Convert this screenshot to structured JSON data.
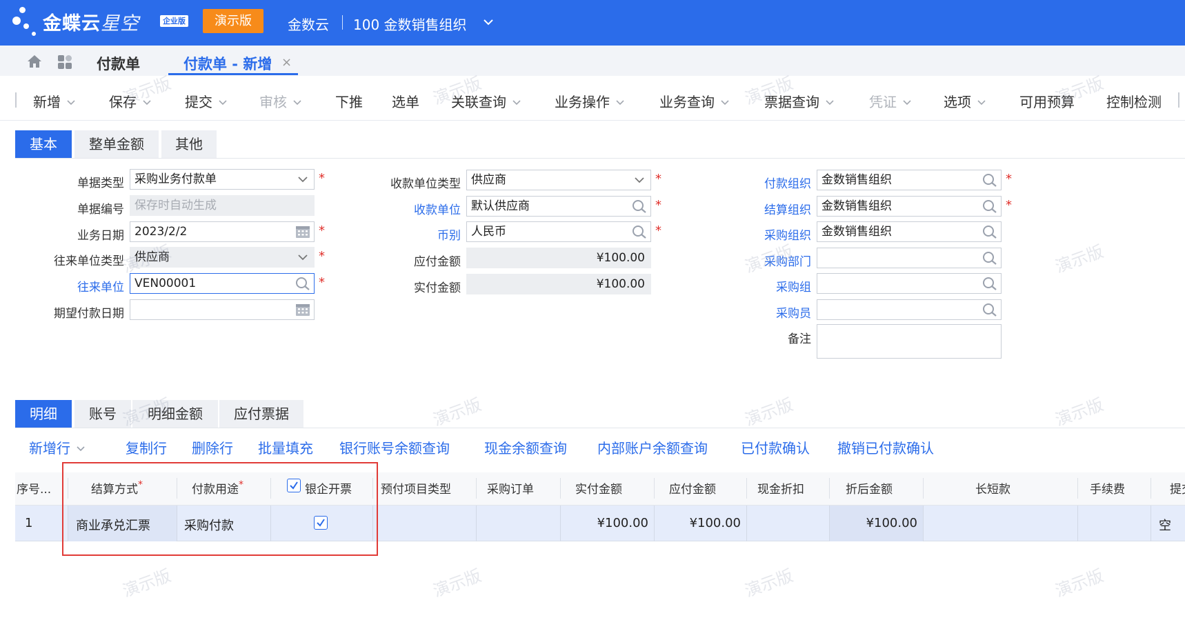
{
  "header": {
    "brand": "金蝶云",
    "brand_sub": "星空",
    "edition": "企业版",
    "demo_badge": "演示版",
    "tenant": "金数云",
    "org": "100 金数销售组织",
    "icons": {
      "logo": "kingdee-logo",
      "org_dropdown": "chevron-down-icon"
    }
  },
  "tabs": {
    "list_tab": "付款单",
    "new_tab": "付款单 - 新增",
    "close": "×"
  },
  "toolbar": {
    "items": [
      {
        "label": "新增",
        "dropdown": true,
        "disabled": false
      },
      {
        "label": "保存",
        "dropdown": true,
        "disabled": false
      },
      {
        "label": "提交",
        "dropdown": true,
        "disabled": false
      },
      {
        "label": "审核",
        "dropdown": true,
        "disabled": true
      },
      {
        "label": "下推",
        "dropdown": false,
        "disabled": false
      },
      {
        "label": "选单",
        "dropdown": false,
        "disabled": false
      },
      {
        "label": "关联查询",
        "dropdown": true,
        "disabled": false
      },
      {
        "label": "业务操作",
        "dropdown": true,
        "disabled": false
      },
      {
        "label": "业务查询",
        "dropdown": true,
        "disabled": false
      },
      {
        "label": "票据查询",
        "dropdown": true,
        "disabled": false
      },
      {
        "label": "凭证",
        "dropdown": true,
        "disabled": true
      },
      {
        "label": "选项",
        "dropdown": true,
        "disabled": false
      },
      {
        "label": "可用预算",
        "dropdown": false,
        "disabled": false
      },
      {
        "label": "控制检测",
        "dropdown": false,
        "disabled": false
      }
    ]
  },
  "form_tabs": [
    "基本",
    "整单金额",
    "其他"
  ],
  "form": {
    "bill_type": {
      "label": "单据类型",
      "value": "采购业务付款单"
    },
    "bill_no": {
      "label": "单据编号",
      "placeholder": "保存时自动生成"
    },
    "biz_date": {
      "label": "业务日期",
      "value": "2023/2/2"
    },
    "contact_type": {
      "label": "往来单位类型",
      "value": "供应商"
    },
    "contact_unit": {
      "label": "往来单位",
      "value": "VEN00001"
    },
    "expected_date": {
      "label": "期望付款日期",
      "value": ""
    },
    "payee_type": {
      "label": "收款单位类型",
      "value": "供应商"
    },
    "payee": {
      "label": "收款单位",
      "value": "默认供应商"
    },
    "currency": {
      "label": "币别",
      "value": "人民币"
    },
    "payable_amount": {
      "label": "应付金额",
      "value": "¥100.00"
    },
    "paid_amount": {
      "label": "实付金额",
      "value": "¥100.00"
    },
    "pay_org": {
      "label": "付款组织",
      "value": "金数销售组织"
    },
    "settle_org": {
      "label": "结算组织",
      "value": "金数销售组织"
    },
    "purchase_org": {
      "label": "采购组织",
      "value": "金数销售组织"
    },
    "purchase_dept": {
      "label": "采购部门",
      "value": ""
    },
    "purchase_group": {
      "label": "采购组",
      "value": ""
    },
    "purchaser": {
      "label": "采购员",
      "value": ""
    },
    "remark": {
      "label": "备注",
      "value": ""
    },
    "required_mark": "*"
  },
  "detail_tabs": [
    "明细",
    "账号",
    "明细金额",
    "应付票据"
  ],
  "detail_actions": [
    "新增行",
    "复制行",
    "删除行",
    "批量填充",
    "银行账号余额查询",
    "现金余额查询",
    "内部账户余额查询",
    "已付款确认",
    "撤销已付款确认"
  ],
  "grid": {
    "columns": [
      "序号...",
      "结算方式",
      "付款用途",
      "银企开票",
      "预付项目类型",
      "采购订单",
      "实付金额",
      "应付金额",
      "现金折扣",
      "折后金额",
      "长短款",
      "手续费",
      "提交"
    ],
    "rows": [
      {
        "seq": "1",
        "settle_method": "商业承兑汇票",
        "purpose": "采购付款",
        "bank_invoice": true,
        "prepay_type": "",
        "po": "",
        "paid": "¥100.00",
        "payable": "¥100.00",
        "discount": "",
        "after_discount": "¥100.00",
        "long_short": "",
        "fee": "",
        "submit": "空"
      }
    ]
  },
  "watermark": "演示版",
  "colors": {
    "primary": "#2b6cea",
    "badge": "#f78b1a",
    "required": "#e0302b",
    "highlight": "#e13b37"
  }
}
